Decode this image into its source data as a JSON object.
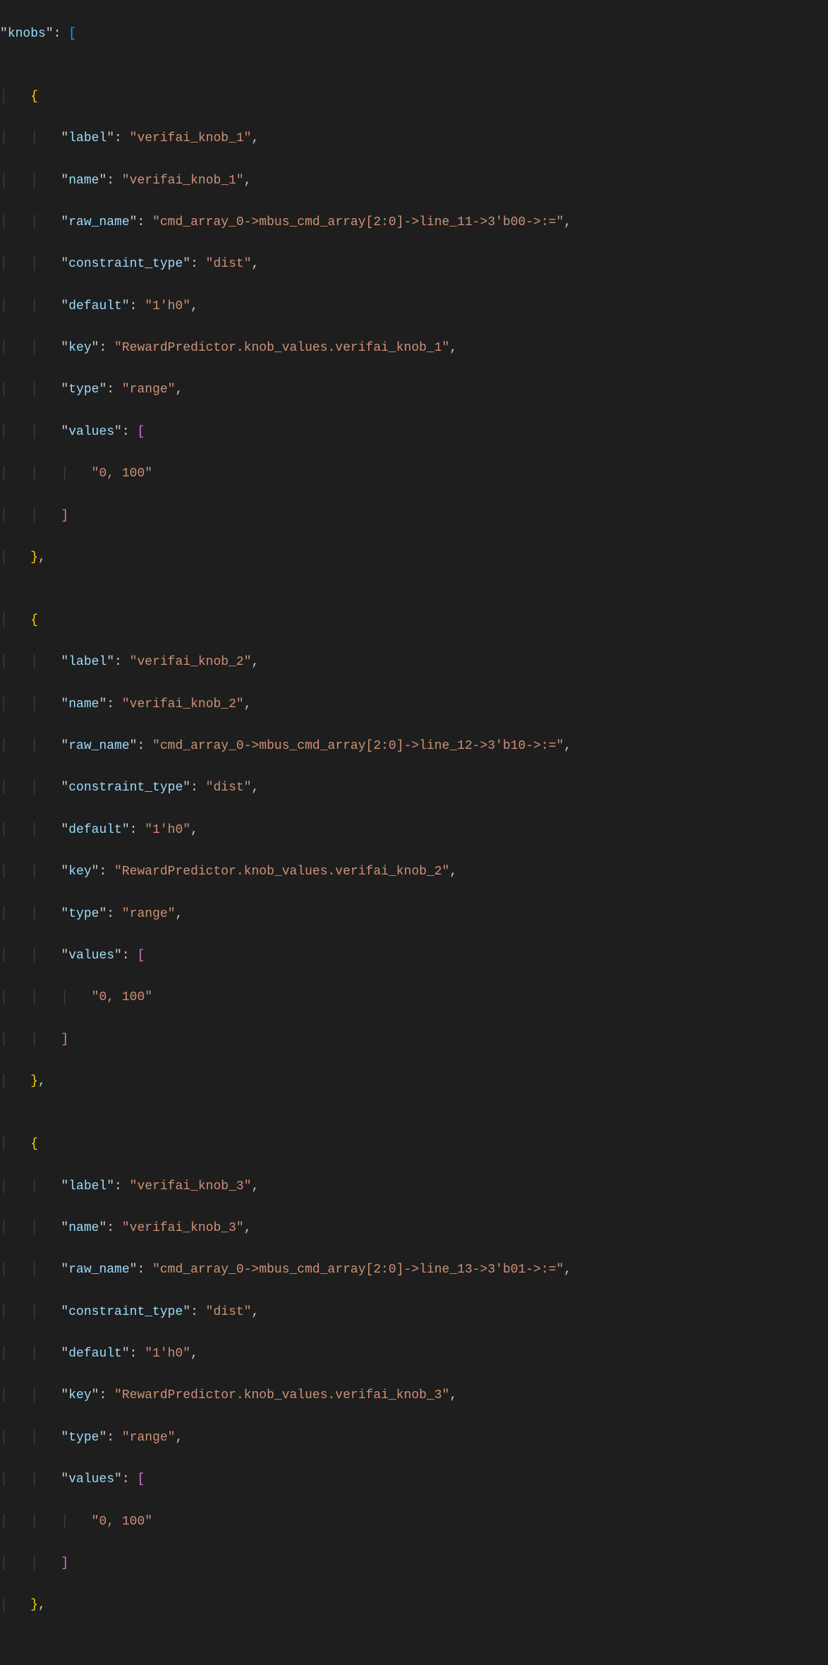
{
  "top_key": "knobs",
  "knobs": [
    {
      "label": "verifai_knob_1",
      "name": "verifai_knob_1",
      "raw_name": "cmd_array_0->mbus_cmd_array[2:0]->line_11->3'b00->:=",
      "constraint_type": "dist",
      "default": "1'h0",
      "key": "RewardPredictor.knob_values.verifai_knob_1",
      "type": "range",
      "values": [
        "0, 100"
      ]
    },
    {
      "label": "verifai_knob_2",
      "name": "verifai_knob_2",
      "raw_name": "cmd_array_0->mbus_cmd_array[2:0]->line_12->3'b10->:=",
      "constraint_type": "dist",
      "default": "1'h0",
      "key": "RewardPredictor.knob_values.verifai_knob_2",
      "type": "range",
      "values": [
        "0, 100"
      ]
    },
    {
      "label": "verifai_knob_3",
      "name": "verifai_knob_3",
      "raw_name": "cmd_array_0->mbus_cmd_array[2:0]->line_13->3'b01->:=",
      "constraint_type": "dist",
      "default": "1'h0",
      "key": "RewardPredictor.knob_values.verifai_knob_3",
      "type": "range",
      "values": [
        "0, 100"
      ]
    }
  ],
  "prop_labels": {
    "label": "label",
    "name": "name",
    "raw_name": "raw_name",
    "constraint_type": "constraint_type",
    "default": "default",
    "key": "key",
    "type": "type",
    "values": "values"
  }
}
